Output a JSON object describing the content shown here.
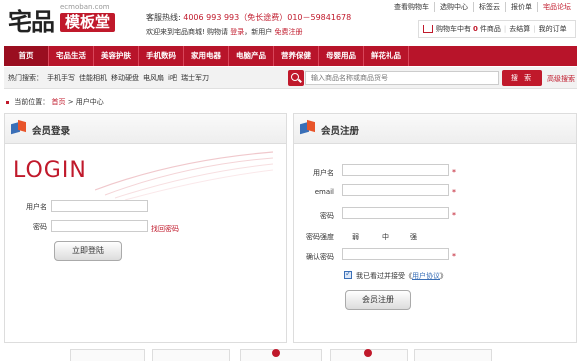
{
  "header": {
    "logo_text": "宅品",
    "logo_site": "ecmoban.com",
    "logo_sub": "模板堂",
    "hotline_label": "客服热线:",
    "hotline_number": "4006 993 993（免长途费）010－59841678",
    "welcome_text": "欢迎来到宅品商城! 购物请",
    "login_link": "登录",
    "new_user_text": "，新用户",
    "register_link": "免费注册",
    "top_links": [
      "查看购物车",
      "选购中心",
      "标签云",
      "报价单",
      "宅品论坛"
    ],
    "cart": {
      "label_prefix": "购物车中有",
      "count": "0",
      "label_suffix": "件商品",
      "checkout": "去结算",
      "my_orders": "我的订单"
    }
  },
  "nav": {
    "items": [
      "首页",
      "宅品生活",
      "美容护肤",
      "手机数码",
      "家用电器",
      "电脑产品",
      "营养保健",
      "母婴用品",
      "鲜花礼品"
    ],
    "active_index": 0
  },
  "search": {
    "hot_label": "热门搜索：",
    "keywords": [
      "手机手写",
      "佳能相机",
      "移动硬盘",
      "电风扇",
      "i吧",
      "瑞士军刀"
    ],
    "placeholder": "输入商品名称或商品货号",
    "button": "搜 索",
    "advanced": "高级搜索"
  },
  "breadcrumb": {
    "prefix": "当前位置：",
    "home": "首页",
    "current": "> 用户中心"
  },
  "login_panel": {
    "title": "会员登录",
    "logo_word": "LOGIN",
    "username_label": "用户名",
    "password_label": "密码",
    "forgot": "找回密码",
    "submit": "立即登陆"
  },
  "register_panel": {
    "title": "会员注册",
    "username_label": "用户名",
    "email_label": "email",
    "password_label": "密码",
    "strength_label": "密码强度",
    "strength_levels": [
      "弱",
      "中",
      "强"
    ],
    "confirm_label": "确认密码",
    "agree_text": "我已看过并接受《",
    "agree_link": "用户协议",
    "agree_end": "》",
    "required_mark": "*",
    "submit": "会员注册"
  },
  "colors": {
    "brand_red": "#b8142a",
    "link_blue": "#3a6fb7"
  }
}
